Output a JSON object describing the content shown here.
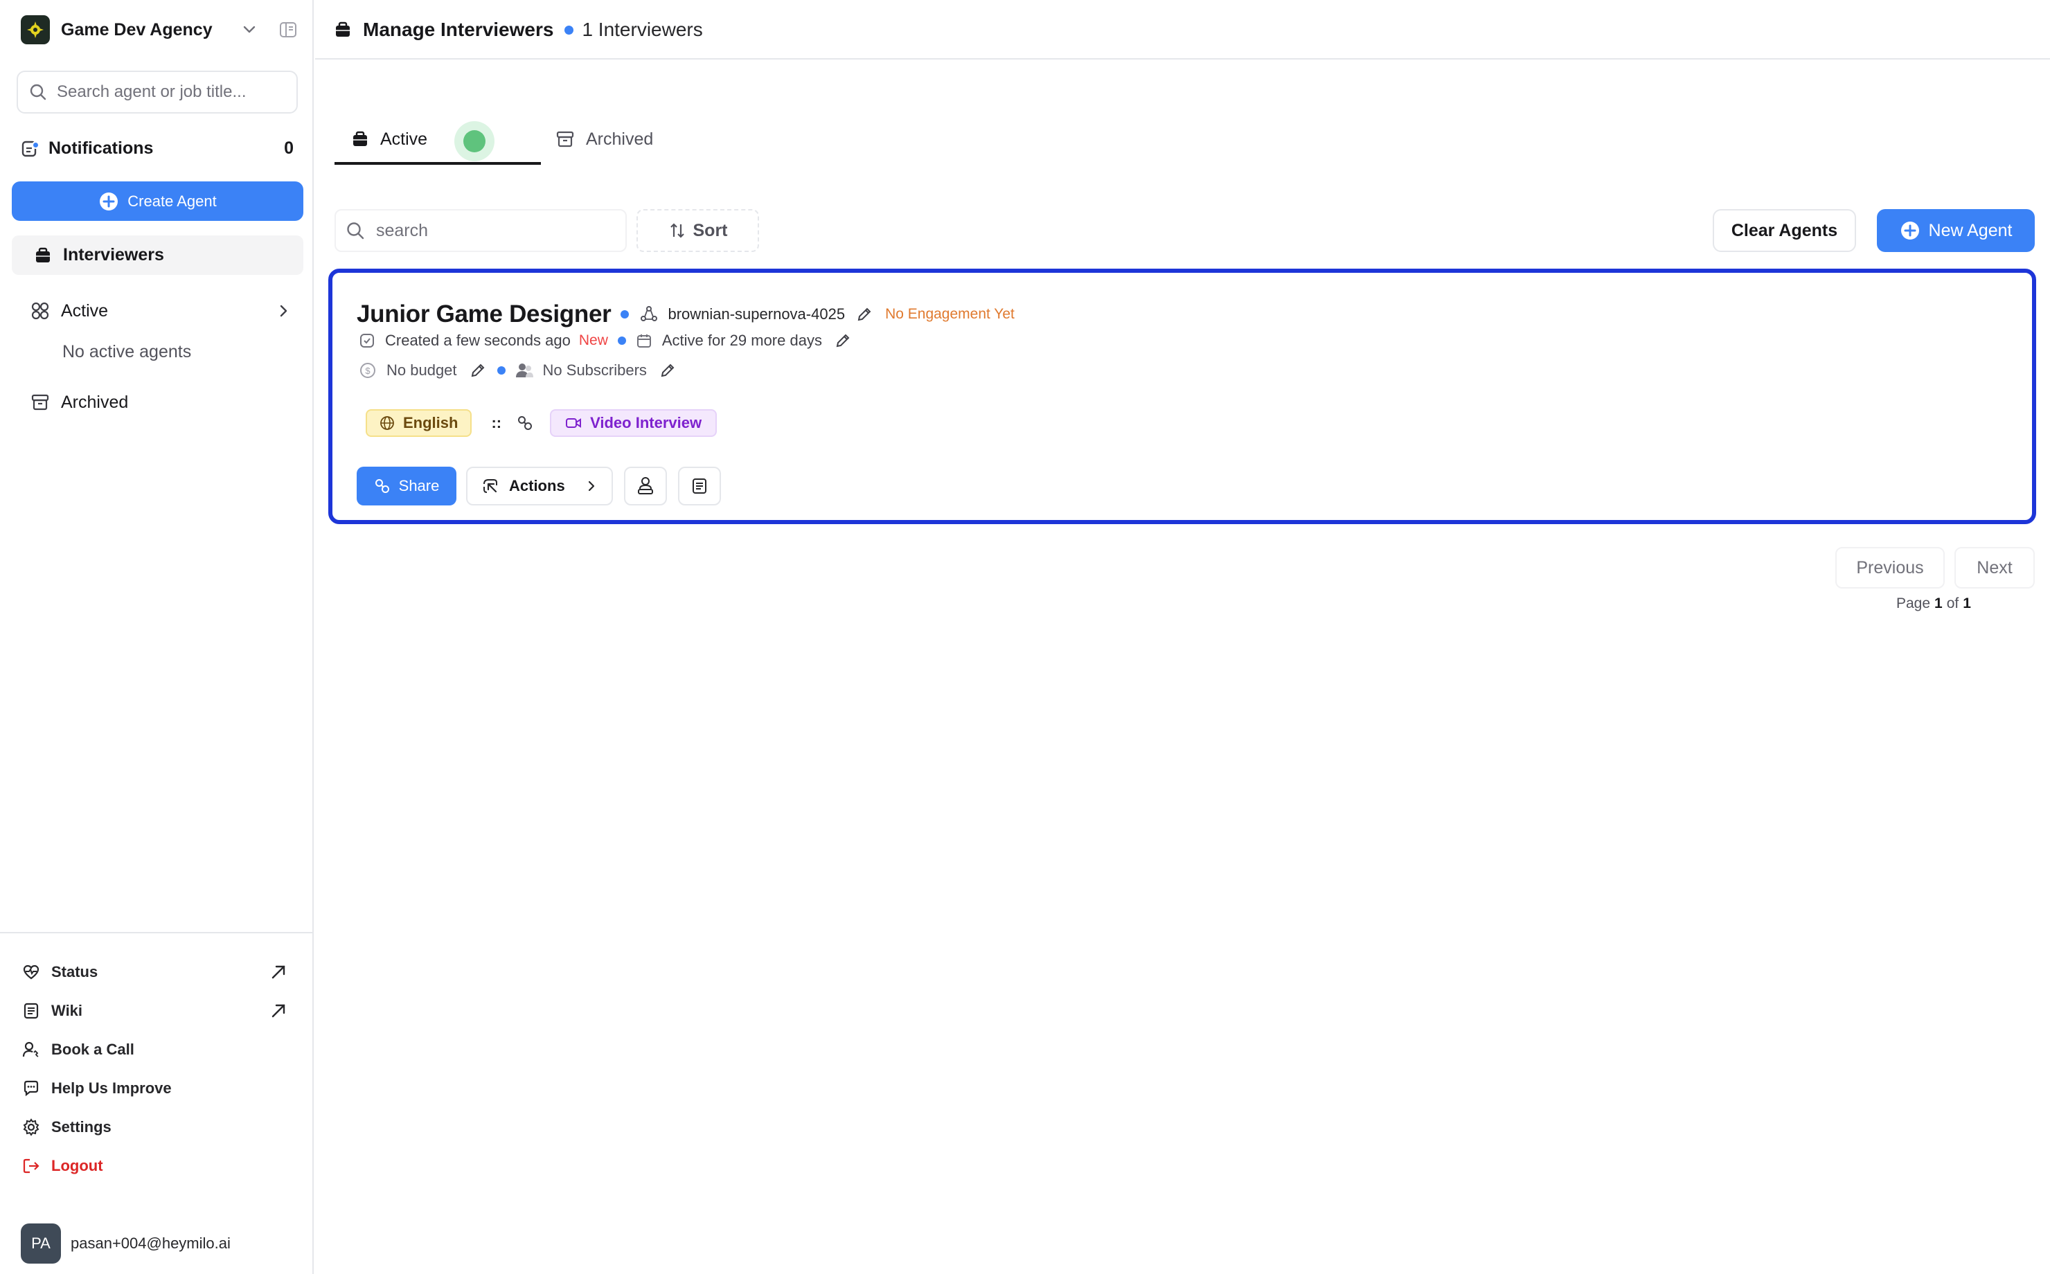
{
  "sidebar": {
    "workspace_name": "Game Dev Agency",
    "search_placeholder": "Search agent or job title...",
    "notifications": {
      "label": "Notifications",
      "count": "0"
    },
    "create_agent_label": "Create Agent",
    "nav": {
      "interviewers": "Interviewers",
      "active": "Active",
      "no_active": "No active agents",
      "archived": "Archived"
    },
    "footer": [
      {
        "label": "Status",
        "icon": "heart-pulse-icon",
        "external": true
      },
      {
        "label": "Wiki",
        "icon": "document-icon",
        "external": true
      },
      {
        "label": "Book a Call",
        "icon": "user-call-icon",
        "external": false
      },
      {
        "label": "Help Us Improve",
        "icon": "chat-icon",
        "external": false
      },
      {
        "label": "Settings",
        "icon": "gear-icon",
        "external": false
      },
      {
        "label": "Logout",
        "icon": "logout-icon",
        "external": false
      }
    ],
    "user": {
      "initials": "PA",
      "email": "pasan+004@heymilo.ai"
    }
  },
  "header": {
    "title": "Manage Interviewers",
    "count_label": "1 Interviewers"
  },
  "tabs": {
    "active": "Active",
    "archived": "Archived"
  },
  "toolbar": {
    "search_placeholder": "search",
    "sort_label": "Sort",
    "clear_label": "Clear Agents",
    "new_label": "New Agent"
  },
  "agent": {
    "title": "Junior Game Designer",
    "slug": "brownian-supernova-4025",
    "engagement": "No Engagement Yet",
    "created": "Created a few seconds ago",
    "new_tag": "New",
    "active_for": "Active for 29 more days",
    "budget": "No budget",
    "subscribers": "No Subscribers",
    "language": "English",
    "separator": "::",
    "interview_type": "Video Interview",
    "share_label": "Share",
    "actions_label": "Actions"
  },
  "pagination": {
    "previous": "Previous",
    "next": "Next",
    "page_prefix": "Page",
    "current": "1",
    "of": "of",
    "total": "1"
  },
  "colors": {
    "accent": "#3b82f6",
    "card_highlight": "#1d35d8",
    "live": "#5fc37d",
    "engagement": "#e07a2f",
    "new": "#ef4444",
    "logout": "#dc2626"
  }
}
